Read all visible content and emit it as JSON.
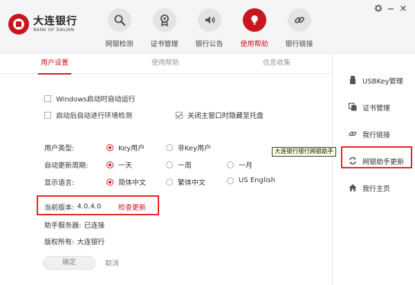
{
  "brand": {
    "name_cn": "大连银行",
    "name_en": "BANK OF DALIAN"
  },
  "nav": [
    {
      "label": "网银检测",
      "icon": "magnifier-icon",
      "active": false
    },
    {
      "label": "证书管理",
      "icon": "certificate-icon",
      "active": false
    },
    {
      "label": "银行公告",
      "icon": "speaker-icon",
      "active": false
    },
    {
      "label": "使用帮助",
      "icon": "lightbulb-icon",
      "active": true
    },
    {
      "label": "银行链接",
      "icon": "link-icon",
      "active": false
    }
  ],
  "window": {
    "settings_icon": "gear-icon",
    "minimize_icon": "minimize-icon",
    "close_icon": "close-icon"
  },
  "tabs": [
    {
      "label": "用户设置",
      "active": true
    },
    {
      "label": "使用帮助",
      "active": false
    },
    {
      "label": "信息收集",
      "active": false
    }
  ],
  "settings": {
    "checkboxes": [
      {
        "label": "Windows启动时自动运行",
        "checked": false
      },
      {
        "label": "启动后自动进行环境检测",
        "checked": false
      },
      {
        "label": "关闭主窗口时隐藏至托盘",
        "checked": true
      }
    ],
    "user_type": {
      "label": "用户类型:",
      "options": [
        "Key用户",
        "非Key用户"
      ],
      "selected": "Key用户"
    },
    "update_cycle": {
      "label": "自动更新周期:",
      "options": [
        "一天",
        "一周",
        "一月"
      ],
      "selected": "一天"
    },
    "language": {
      "label": "显示语言:",
      "options": [
        "简体中文",
        "繁体中文",
        "US English"
      ],
      "selected": "简体中文"
    },
    "version": {
      "label": "当前版本:",
      "value": "4.0.4.0",
      "check_update": "检查更新"
    },
    "server": {
      "label": "助手服务器:",
      "value": "已连接"
    },
    "copyright": {
      "label": "版权所有:",
      "value": "大连银行"
    },
    "ok_label": "确定",
    "cancel_label": "取消"
  },
  "sidebar": [
    {
      "label": "USBKey管理",
      "icon": "usbkey-icon"
    },
    {
      "label": "证书管理",
      "icon": "certificate-icon"
    },
    {
      "label": "我行链接",
      "icon": "link-icon"
    },
    {
      "label": "网银助手更新",
      "icon": "refresh-icon"
    },
    {
      "label": "我行主页",
      "icon": "home-icon"
    }
  ],
  "tooltip": "大连银行银行网银助手",
  "colors": {
    "accent": "#c8161d",
    "highlight_box": "#e51c23"
  }
}
